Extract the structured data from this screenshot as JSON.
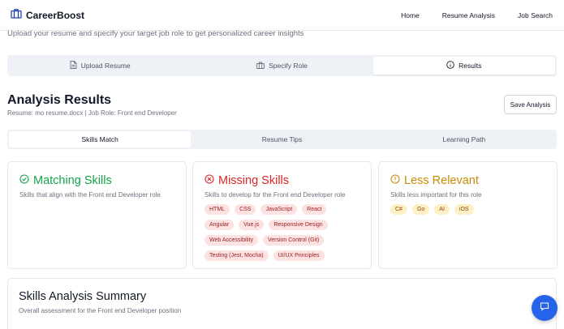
{
  "brand": {
    "name": "CareerBoost"
  },
  "nav": {
    "links": [
      "Home",
      "Resume Analysis",
      "Job Search"
    ]
  },
  "intro": "Upload your resume and specify your target job role to get personalized career insights",
  "steps": [
    {
      "label": "Upload Resume",
      "icon": "file-icon"
    },
    {
      "label": "Specify Role",
      "icon": "briefcase-icon"
    },
    {
      "label": "Results",
      "icon": "info-icon",
      "active": true
    }
  ],
  "results": {
    "title": "Analysis Results",
    "meta": "Resume: mo resume.docx | Job Role: Front end Developer",
    "save_label": "Save Analysis"
  },
  "tabs": [
    {
      "label": "Skills Match",
      "active": true
    },
    {
      "label": "Resume Tips"
    },
    {
      "label": "Learning Path"
    }
  ],
  "matching": {
    "title": "Matching Skills",
    "desc": "Skills that align with the Front end Developer role",
    "color": "#16a34a"
  },
  "missing": {
    "title": "Missing Skills",
    "desc": "Skills to develop for the Front end Developer role",
    "color": "#dc2626",
    "skills": [
      "HTML",
      "CSS",
      "JavaScript",
      "React",
      "Angular",
      "Vue.js",
      "Responsive Design",
      "Web Accessibility",
      "Version Control (Git)",
      "Testing (Jest, Mocha)",
      "UI/UX Principles"
    ]
  },
  "less": {
    "title": "Less Relevant",
    "desc": "Skills less important for this role",
    "color": "#ca8a04",
    "skills": [
      "C#",
      "Go",
      "AI",
      "iOS"
    ]
  },
  "summary": {
    "title": "Skills Analysis Summary",
    "desc": "Overall assessment for the Front end Developer position"
  },
  "chat": {
    "icon": "chat-icon",
    "color": "#2563eb"
  }
}
